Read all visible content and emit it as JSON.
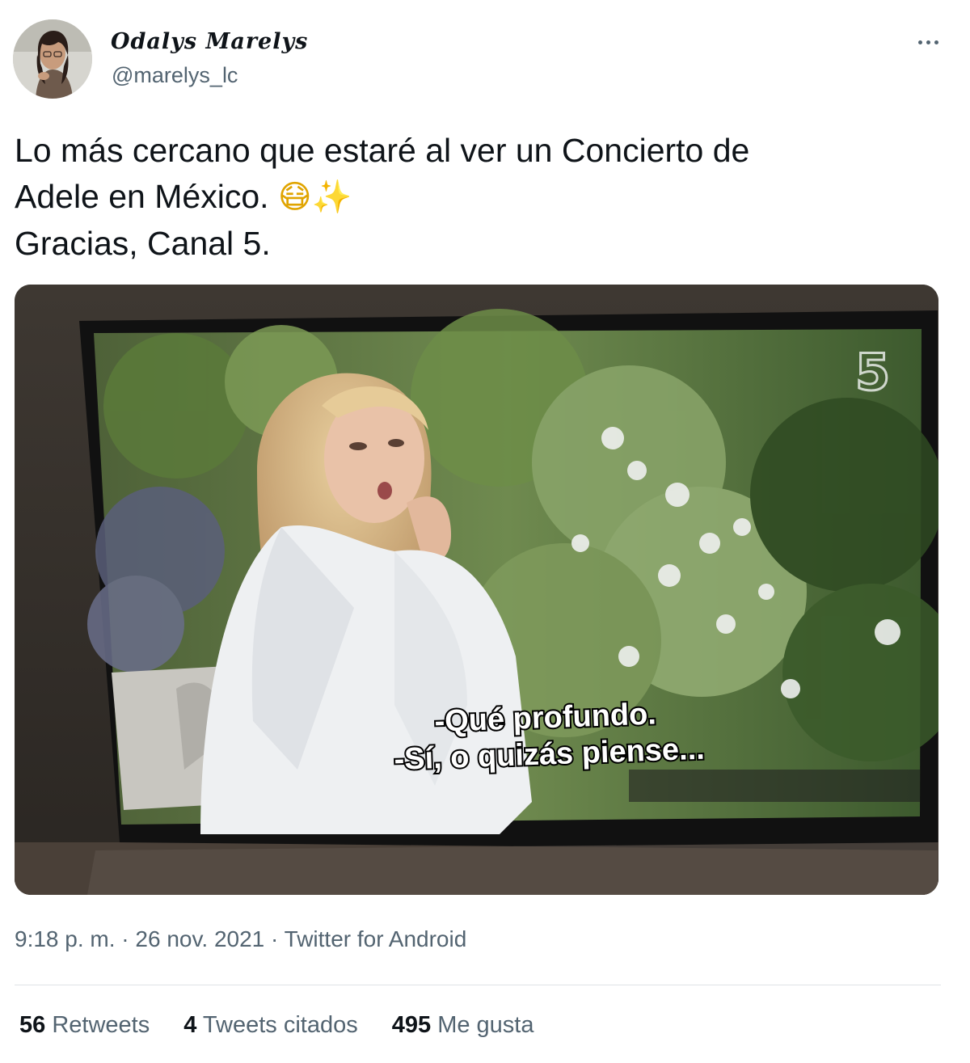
{
  "author": {
    "display_name": "Odalys Marelys",
    "handle": "@marelys_lc",
    "avatar_icon": "profile-photo"
  },
  "more_icon": "ellipsis-icon",
  "tweet": {
    "lines": [
      "Lo más cercano que estaré al ver un Concierto de",
      "Adele en México.",
      "Gracias, Canal 5."
    ],
    "emoji": {
      "sneeze": "😷",
      "sparkles": "✨"
    }
  },
  "media": {
    "channel_logo": "5",
    "subtitles": [
      "-Qué profundo.",
      "-Sí, o quizás piense..."
    ]
  },
  "meta": {
    "time": "9:18 p. m.",
    "separator": " · ",
    "date": "26 nov. 2021",
    "source": "Twitter for Android"
  },
  "stats": {
    "retweets": {
      "count": "56",
      "label": "Retweets"
    },
    "quotes": {
      "count": "4",
      "label": "Tweets citados"
    },
    "likes": {
      "count": "495",
      "label": "Me gusta"
    }
  },
  "colors": {
    "text": "#0f1419",
    "secondary": "#536471",
    "divider": "#dfe3e6"
  }
}
